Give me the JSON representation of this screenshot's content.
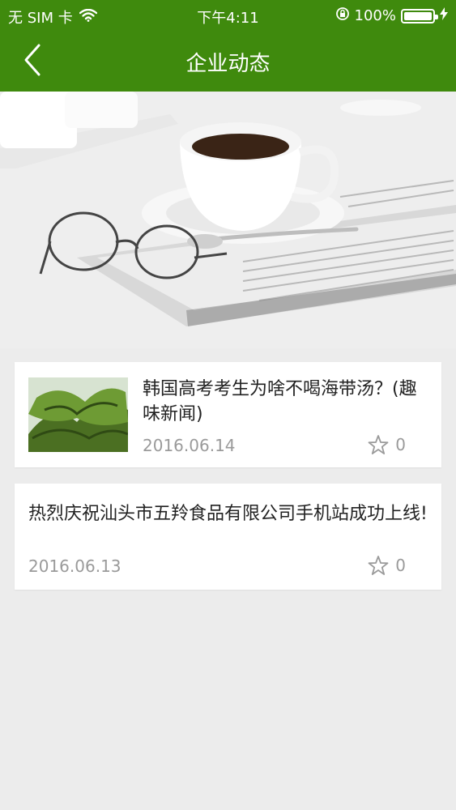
{
  "status_bar": {
    "carrier": "无 SIM 卡",
    "time": "下午4:11",
    "battery_percent": "100%",
    "battery_level": 1.0
  },
  "nav": {
    "title": "企业动态"
  },
  "articles": [
    {
      "title": "韩国高考考生为啥不喝海带汤？(趣味新闻)",
      "date": "2016.06.14",
      "favorites": "0"
    },
    {
      "title": "热烈庆祝汕头市五羚食品有限公司手机站成功上线!",
      "date": "2016.06.13",
      "favorites": "0"
    }
  ],
  "colors": {
    "header_green": "#3f8a0d",
    "background": "#ececec",
    "muted_text": "#9a9a9a"
  },
  "icons": [
    "back-chevron-icon",
    "wifi-icon",
    "lock-rotation-icon",
    "battery-icon",
    "charging-bolt-icon",
    "star-icon"
  ]
}
